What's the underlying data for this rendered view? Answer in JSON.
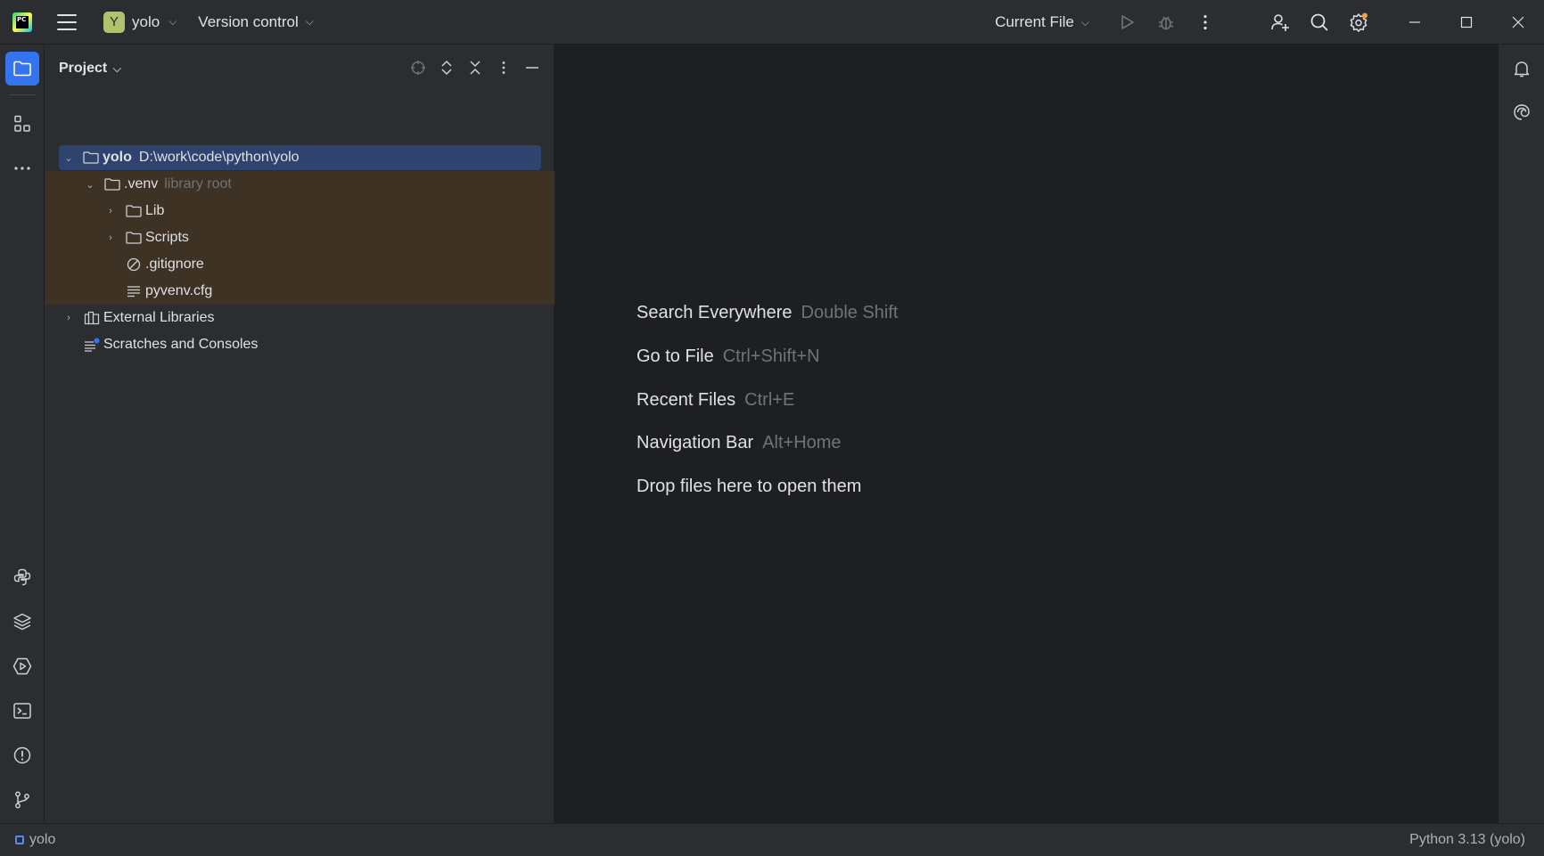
{
  "titlebar": {
    "project_badge": "Y",
    "project_name": "yolo",
    "vcs_label": "Version control",
    "run_config": "Current File"
  },
  "project_panel": {
    "title": "Project",
    "tree": [
      {
        "name": "yolo",
        "extra": "D:\\work\\code\\python\\yolo",
        "level": 0,
        "expanded": true,
        "selected": true
      },
      {
        "name": ".venv",
        "extra": "library root",
        "level": 1,
        "expanded": true
      },
      {
        "name": "Lib",
        "level": 2,
        "expanded": false
      },
      {
        "name": "Scripts",
        "level": 2,
        "expanded": false
      },
      {
        "name": ".gitignore",
        "level": 2
      },
      {
        "name": "pyvenv.cfg",
        "level": 2
      },
      {
        "name": "External Libraries",
        "level": 0,
        "expanded": false
      },
      {
        "name": "Scratches and Consoles",
        "level": 0
      }
    ]
  },
  "editor": {
    "hints": [
      {
        "action": "Search Everywhere",
        "shortcut": "Double Shift"
      },
      {
        "action": "Go to File",
        "shortcut": "Ctrl+Shift+N"
      },
      {
        "action": "Recent Files",
        "shortcut": "Ctrl+E"
      },
      {
        "action": "Navigation Bar",
        "shortcut": "Alt+Home"
      },
      {
        "action": "Drop files here to open them",
        "shortcut": ""
      }
    ]
  },
  "statusbar": {
    "project": "yolo",
    "interpreter": "Python 3.13 (yolo)"
  },
  "colors": {
    "accent": "#3574f0",
    "selection": "#2e436e",
    "excluded_bg": "#3d3223",
    "project_badge": "#b1c26f",
    "notification_dot": "#f0a732"
  }
}
